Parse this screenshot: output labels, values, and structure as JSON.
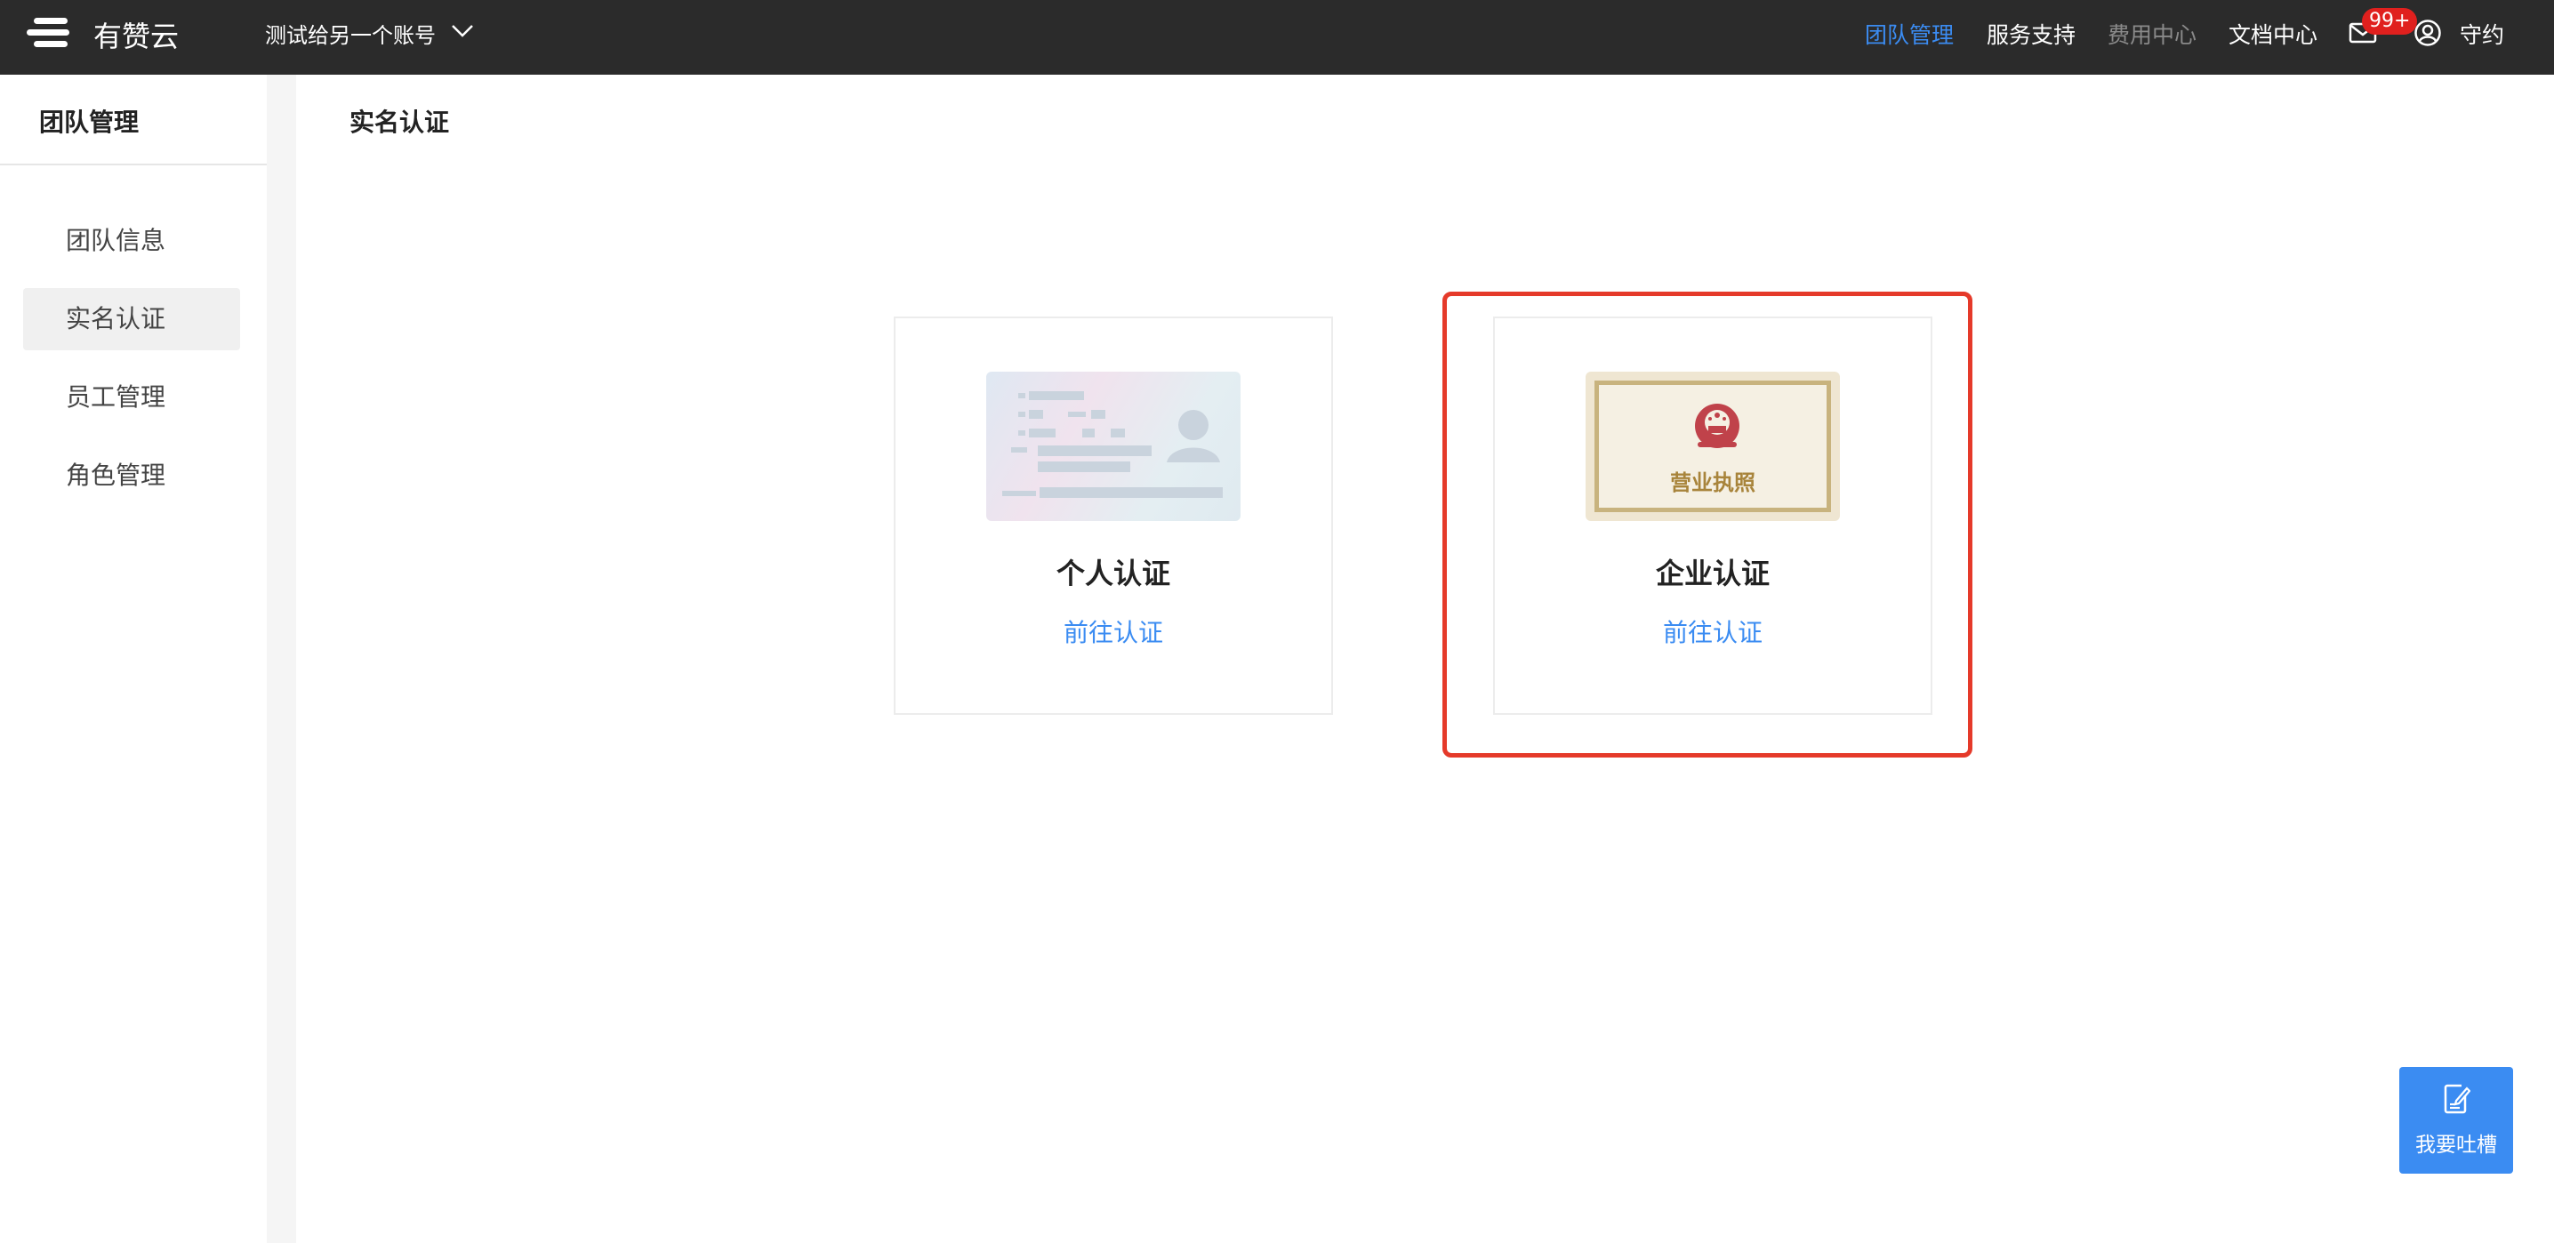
{
  "app": {
    "name": "有赞云",
    "account_name": "测试给另一个账号"
  },
  "topnav": {
    "items": [
      {
        "label": "团队管理",
        "state": "active"
      },
      {
        "label": "服务支持",
        "state": "normal"
      },
      {
        "label": "费用中心",
        "state": "disabled"
      },
      {
        "label": "文档中心",
        "state": "normal"
      }
    ],
    "message_badge": "99+",
    "username": "守约"
  },
  "sidebar": {
    "title": "团队管理",
    "items": [
      {
        "label": "团队信息"
      },
      {
        "label": "实名认证",
        "selected": true
      },
      {
        "label": "员工管理"
      },
      {
        "label": "角色管理"
      }
    ]
  },
  "main": {
    "title": "实名认证",
    "cards": [
      {
        "title": "个人认证",
        "link": "前往认证",
        "image": "id-card"
      },
      {
        "title": "企业认证",
        "link": "前往认证",
        "image": "business-license",
        "license_text": "营业执照"
      }
    ]
  },
  "feedback": {
    "label": "我要吐槽",
    "icon": "edit-note-icon"
  },
  "colors": {
    "accent": "#3b8cf2",
    "topbar": "#2b2b2b",
    "highlight": "#e53a2a",
    "badge": "#e0201e"
  }
}
